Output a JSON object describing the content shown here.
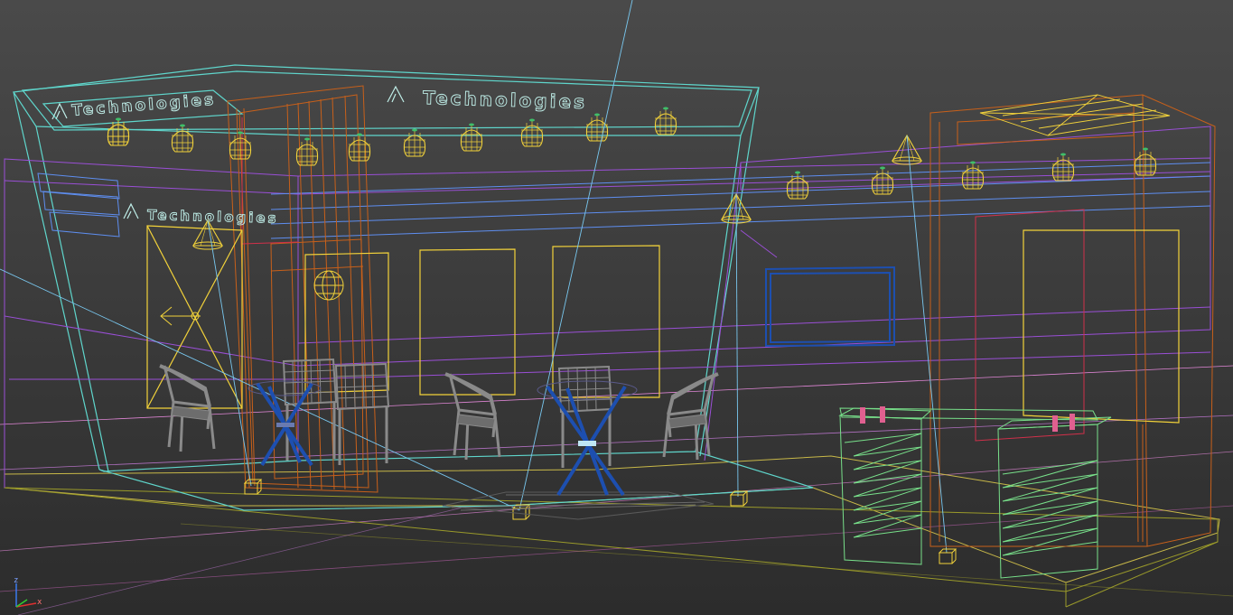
{
  "viewport": {
    "view": "perspective-wireframe",
    "background_top": "#4a4a4a",
    "background_bottom": "#2c2c2c"
  },
  "signage": {
    "main_sign_text": "Technologies",
    "left_sign_text": "Technologies",
    "lower_sign_text": "Technologies"
  },
  "axis_gizmo": {
    "z_label": "z",
    "x_label": "x"
  },
  "colors": {
    "cyan": "#5fd6cc",
    "purple": "#9a4fd6",
    "light_blue": "#5e8ef0",
    "yellow": "#f2d23a",
    "orange": "#c8601a",
    "red": "#d0304a",
    "green": "#78e08a",
    "pink": "#e086d6",
    "gray": "#8a8a8a",
    "blue": "#1d4fb0",
    "olive": "#9a9a2a"
  },
  "objects": {
    "pendant_lamps": 16,
    "spot_lights": 3,
    "chairs": 7,
    "tables": 2,
    "display_counters": 2,
    "light_targets": 5
  }
}
